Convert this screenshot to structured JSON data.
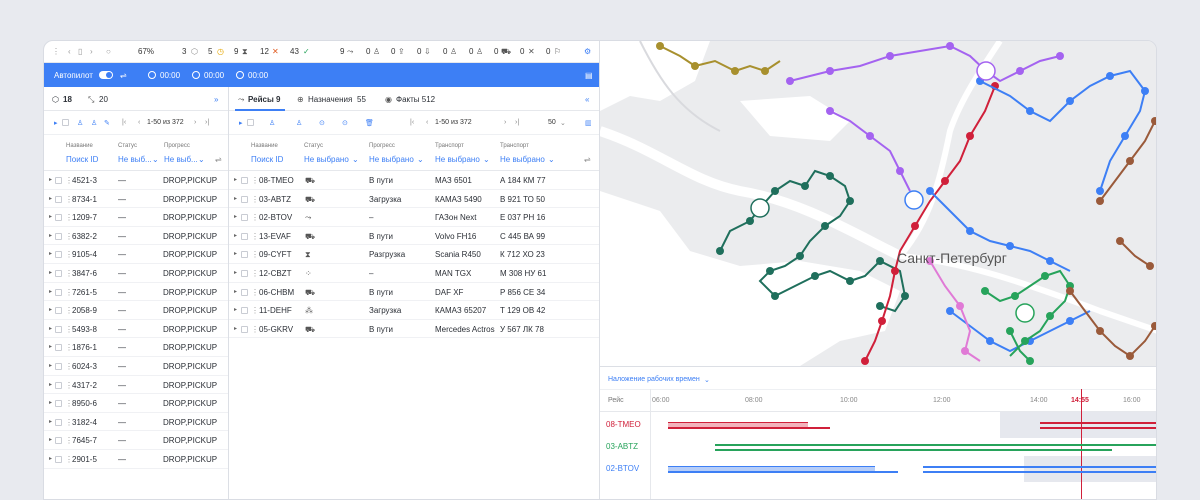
{
  "stats": {
    "zoom": "67%",
    "count_boxes": "3",
    "count_clock": "5",
    "count_hourglass": "9",
    "count_cancel": "12",
    "count_check": "43",
    "count_route": "9",
    "count_user": "0",
    "count_upload": "0",
    "count_download": "0",
    "count_user2": "0",
    "count_user3": "0",
    "count_truck": "0",
    "count_x": "0",
    "count_flag": "0"
  },
  "autopilot": {
    "label": "Автопилот",
    "t1": "00:00",
    "t2": "00:00",
    "t3": "00:00"
  },
  "left_tabs": {
    "orders_count": "18",
    "groups_count": "20"
  },
  "left_pager": "1-50 из 372",
  "left_cols": {
    "name": "Название",
    "name_filter": "Поиск ID",
    "status": "Статус",
    "status_filter": "Не выб...",
    "progress": "Прогресс",
    "progress_filter": "Не выб..."
  },
  "orders": [
    {
      "id": "4521-3",
      "status": "—",
      "progress": "DROP,PICKUP"
    },
    {
      "id": "8734-1",
      "status": "—",
      "progress": "DROP,PICKUP"
    },
    {
      "id": "1209-7",
      "status": "—",
      "progress": "DROP,PICKUP"
    },
    {
      "id": "6382-2",
      "status": "—",
      "progress": "DROP,PICKUP"
    },
    {
      "id": "9105-4",
      "status": "—",
      "progress": "DROP,PICKUP"
    },
    {
      "id": "3847-6",
      "status": "—",
      "progress": "DROP,PICKUP"
    },
    {
      "id": "7261-5",
      "status": "—",
      "progress": "DROP,PICKUP"
    },
    {
      "id": "2058-9",
      "status": "—",
      "progress": "DROP,PICKUP"
    },
    {
      "id": "5493-8",
      "status": "—",
      "progress": "DROP,PICKUP"
    },
    {
      "id": "1876-1",
      "status": "—",
      "progress": "DROP,PICKUP"
    },
    {
      "id": "6024-3",
      "status": "—",
      "progress": "DROP,PICKUP"
    },
    {
      "id": "4317-2",
      "status": "—",
      "progress": "DROP,PICKUP"
    },
    {
      "id": "8950-6",
      "status": "—",
      "progress": "DROP,PICKUP"
    },
    {
      "id": "3182-4",
      "status": "—",
      "progress": "DROP,PICKUP"
    },
    {
      "id": "7645-7",
      "status": "—",
      "progress": "DROP,PICKUP"
    },
    {
      "id": "2901-5",
      "status": "—",
      "progress": "DROP,PICKUP"
    }
  ],
  "mid_tabs": {
    "trips": "Рейсы 9",
    "assignments": "Назначения",
    "assignments_count": "55",
    "facts": "Факты 512"
  },
  "mid_pager": "1-50 из 372",
  "mid_page_size": "50",
  "mid_cols": {
    "name": "Название",
    "name_filter": "Поиск ID",
    "status": "Статус",
    "status_filter": "Не выбрано",
    "progress": "Прогресс",
    "progress_filter": "Не выбрано",
    "transport": "Транспорт",
    "transport_filter": "Не выбрано",
    "transport2": "Транспорт",
    "transport2_filter": "Не выбрано"
  },
  "trips": [
    {
      "id": "08-TMEO",
      "icon": "truck-icon",
      "progress": "В пути",
      "transport": "МАЗ 6501",
      "plate": "А 184 КМ 77"
    },
    {
      "id": "03-ABTZ",
      "icon": "truck-icon",
      "progress": "Загрузка",
      "transport": "КАМАЗ 5490",
      "plate": "В 921 ТО 50"
    },
    {
      "id": "02-BTOV",
      "icon": "route-icon",
      "progress": "–",
      "transport": "ГАЗон Next",
      "plate": "Е 037 РН 16"
    },
    {
      "id": "13-EVAF",
      "icon": "truck-icon",
      "progress": "В пути",
      "transport": "Volvo FH16",
      "plate": "С 445 ВА 99"
    },
    {
      "id": "09-CYFT",
      "icon": "hourglass-icon",
      "progress": "Разгрузка",
      "transport": "Scania R450",
      "plate": "К 712 ХО 23"
    },
    {
      "id": "12-CBZT",
      "icon": "dots-icon",
      "progress": "–",
      "transport": "MAN TGX",
      "plate": "М 308 НУ 61"
    },
    {
      "id": "06-CHBM",
      "icon": "truck-icon",
      "progress": "В пути",
      "transport": "DAF XF",
      "plate": "Р 856 СЕ 34"
    },
    {
      "id": "11-DEHF",
      "icon": "people-icon",
      "progress": "Загрузка",
      "transport": "КАМАЗ 65207",
      "plate": "Т 129 ОВ 42"
    },
    {
      "id": "05-GKRV",
      "icon": "truck-icon",
      "progress": "В пути",
      "transport": "Mercedes Actros",
      "plate": "У 567 ЛК 78"
    }
  ],
  "map": {
    "city_label": "Санкт-Петербург"
  },
  "gantt": {
    "overlay_label": "Наложение рабочих времен",
    "col_label": "Рейс",
    "times": [
      "06:00",
      "08:00",
      "10:00",
      "12:00",
      "14:00",
      "14:55",
      "16:00"
    ],
    "now": "14:55",
    "rows": [
      {
        "id": "08-TMEO",
        "color": "#d0203a"
      },
      {
        "id": "03-ABTZ",
        "color": "#27a35b"
      },
      {
        "id": "02-BTOV",
        "color": "#3d7ff5"
      }
    ]
  },
  "colors": {
    "accent": "#3d7ff5",
    "red": "#d0203a",
    "green": "#27a35b",
    "teal": "#1f6f5c",
    "purple": "#a463f0",
    "brown": "#9a5a3a",
    "olive": "#a8902e",
    "pink": "#e07ad6"
  }
}
